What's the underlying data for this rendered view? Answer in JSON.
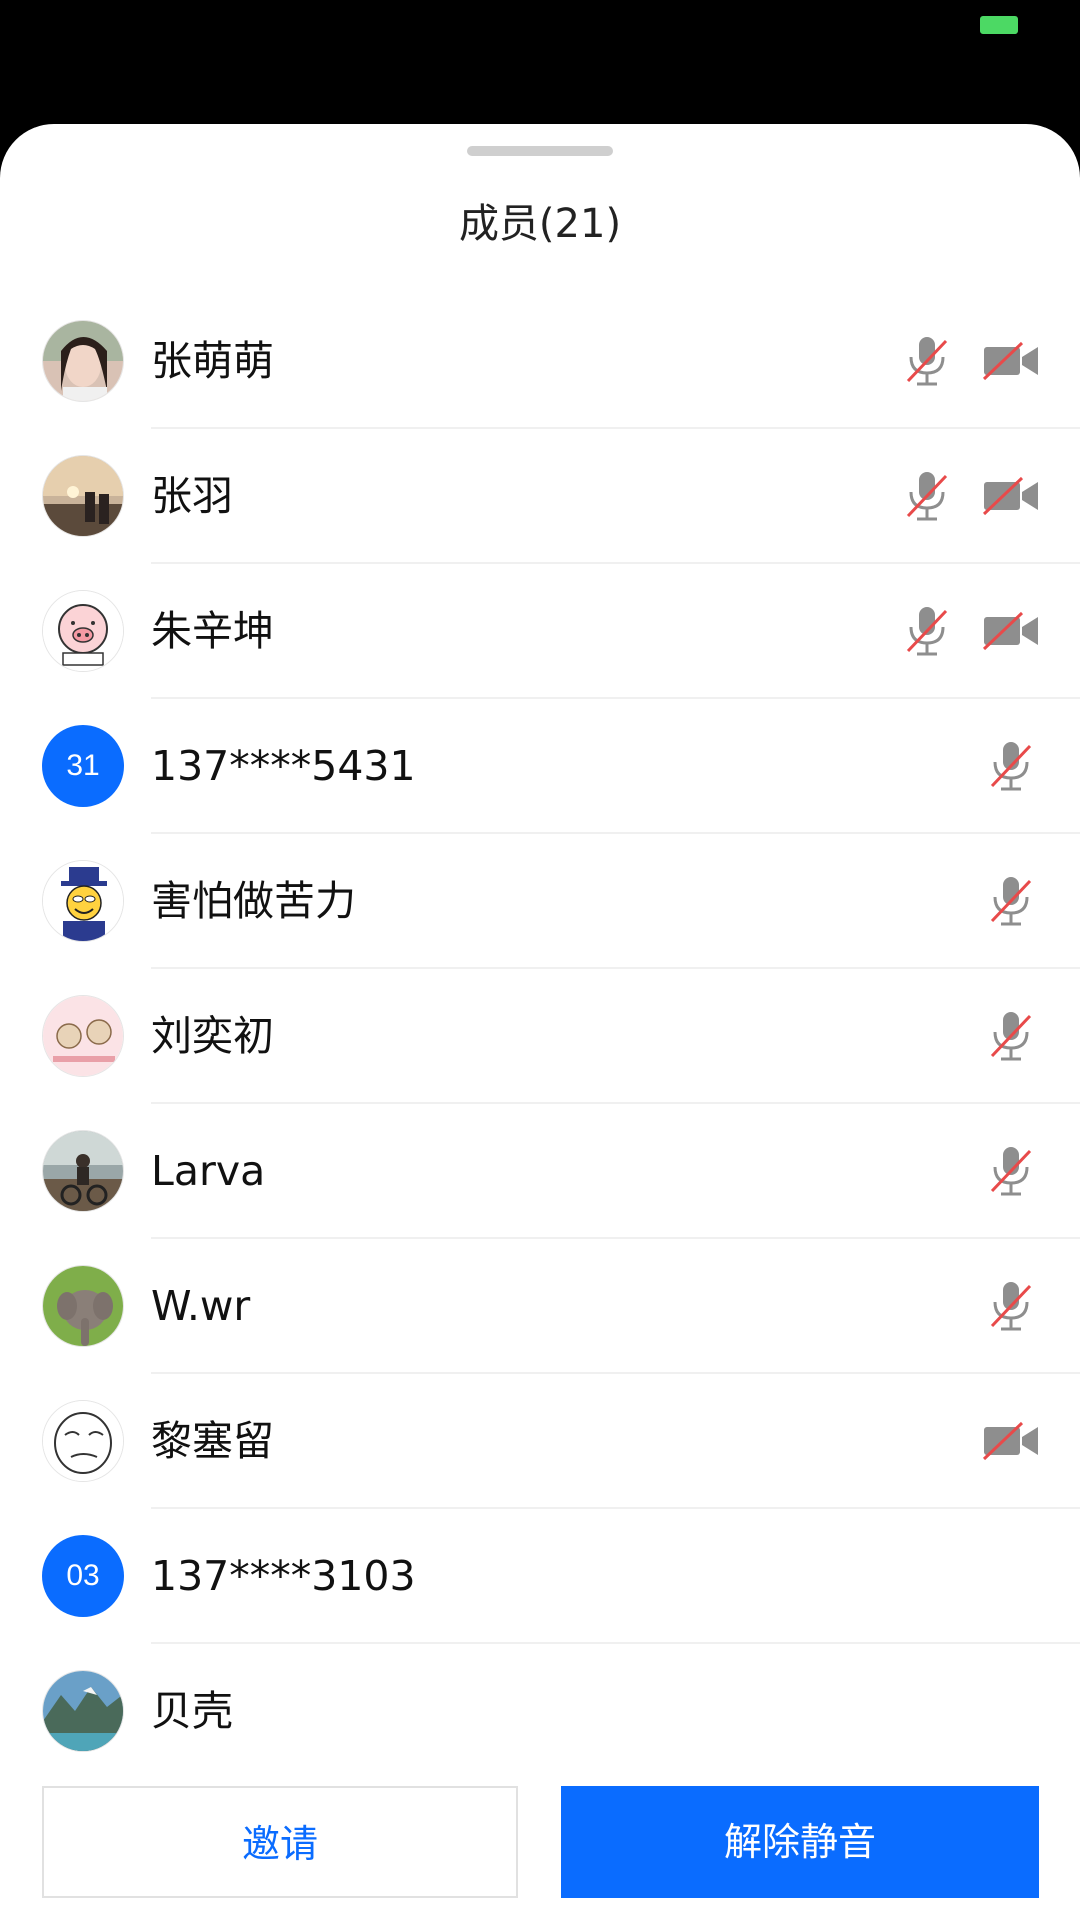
{
  "sheet": {
    "title": "成员(21)"
  },
  "members": [
    {
      "name": "张萌萌",
      "avatar": "photo-woman",
      "mic_muted": true,
      "camera_off": true
    },
    {
      "name": "张羽",
      "avatar": "photo-sunset",
      "mic_muted": true,
      "camera_off": true
    },
    {
      "name": "朱辛坤",
      "avatar": "pig-cartoon",
      "mic_muted": true,
      "camera_off": true
    },
    {
      "name": "137****5431",
      "avatar_initials": "31",
      "mic_muted": true,
      "camera_off": false
    },
    {
      "name": "害怕做苦力",
      "avatar": "uncle-sam-cartoon",
      "mic_muted": true,
      "camera_off": false
    },
    {
      "name": "刘奕初",
      "avatar": "bear-cartoon",
      "mic_muted": true,
      "camera_off": false
    },
    {
      "name": "Larva",
      "avatar": "photo-cyclist",
      "mic_muted": true,
      "camera_off": false
    },
    {
      "name": "W.wr",
      "avatar": "photo-elephant",
      "mic_muted": true,
      "camera_off": false
    },
    {
      "name": "黎塞留",
      "avatar": "meme-face",
      "mic_muted": false,
      "camera_off": true
    },
    {
      "name": "137****3103",
      "avatar_initials": "03",
      "mic_muted": false,
      "camera_off": false
    },
    {
      "name": "贝壳",
      "avatar": "photo-landscape",
      "mic_muted": false,
      "camera_off": false
    }
  ],
  "icons": {
    "mic_muted": "mic-muted-icon",
    "camera_off": "camera-off-icon"
  },
  "footer": {
    "invite_label": "邀请",
    "unmute_label": "解除静音"
  },
  "colors": {
    "accent": "#0a6cff",
    "icon_gray": "#8e8e8e",
    "slash_red": "#e84a4a",
    "battery": "#4cd964"
  }
}
